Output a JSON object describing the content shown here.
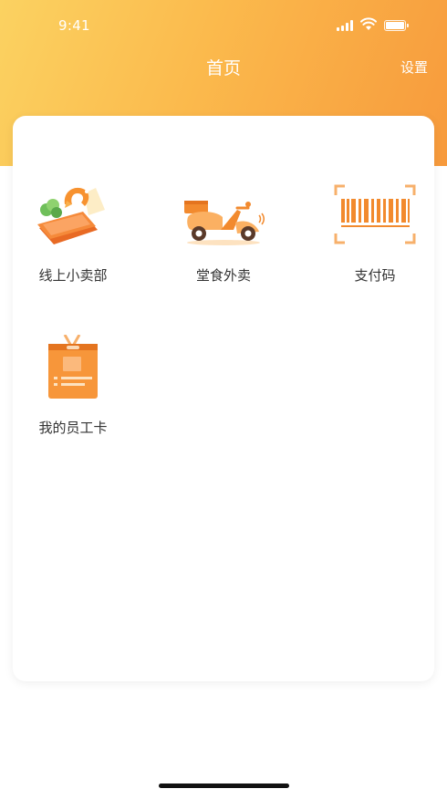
{
  "status_bar": {
    "time": "9:41"
  },
  "nav": {
    "title": "首页",
    "settings_label": "设置"
  },
  "tiles": [
    {
      "label": "线上小卖部",
      "icon": "online-shop-icon"
    },
    {
      "label": "堂食外卖",
      "icon": "scooter-delivery-icon"
    },
    {
      "label": "支付码",
      "icon": "barcode-icon"
    },
    {
      "label": "我的员工卡",
      "icon": "employee-badge-icon"
    }
  ],
  "colors": {
    "header_start": "#fbd261",
    "header_end": "#f79a3c",
    "accent": "#f28a2e"
  }
}
